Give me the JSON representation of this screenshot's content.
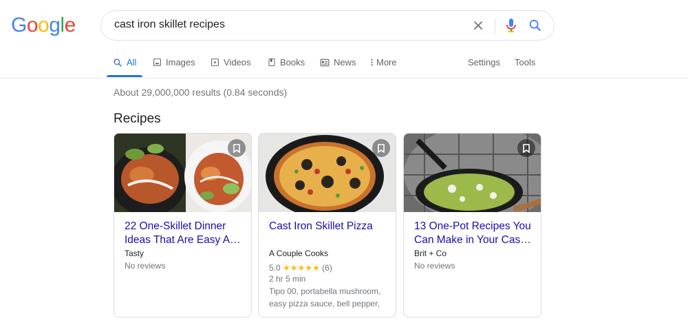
{
  "logo": {
    "letters": [
      "G",
      "o",
      "o",
      "g",
      "l",
      "e"
    ],
    "colors": [
      "#4285F4",
      "#EA4335",
      "#FBBC05",
      "#4285F4",
      "#34A853",
      "#EA4335"
    ]
  },
  "search": {
    "query": "cast iron skillet recipes"
  },
  "tabs": [
    {
      "label": "All",
      "icon": "search-icon",
      "active": true
    },
    {
      "label": "Images",
      "icon": "image-icon"
    },
    {
      "label": "Videos",
      "icon": "video-icon"
    },
    {
      "label": "Books",
      "icon": "book-icon"
    },
    {
      "label": "News",
      "icon": "news-icon"
    },
    {
      "label": "More",
      "icon": "more-vert-icon"
    }
  ],
  "tools": {
    "settings": "Settings",
    "tools": "Tools"
  },
  "results": {
    "stats": "About 29,000,000 results (0.84 seconds)"
  },
  "recipes": {
    "section_title": "Recipes",
    "cards": [
      {
        "title": "22 One-Skillet Dinner Ideas That Are Easy A…",
        "source": "Tasty",
        "reviews": "No reviews"
      },
      {
        "title": "Cast Iron Skillet Pizza",
        "source": "A Couple Cooks",
        "rating": "5.0",
        "stars": "★★★★★",
        "rating_count": "(6)",
        "time": "2 hr 5 min",
        "ingredients": "Tipo 00, portabella mushroom, easy pizza sauce, bell pepper,"
      },
      {
        "title": "13 One-Pot Recipes You Can Make in Your Cas…",
        "source": "Brit + Co",
        "reviews": "No reviews"
      }
    ]
  },
  "colors": {
    "accent": "#1a73e8",
    "link": "#1a0dab",
    "star": "#fbbc04"
  }
}
